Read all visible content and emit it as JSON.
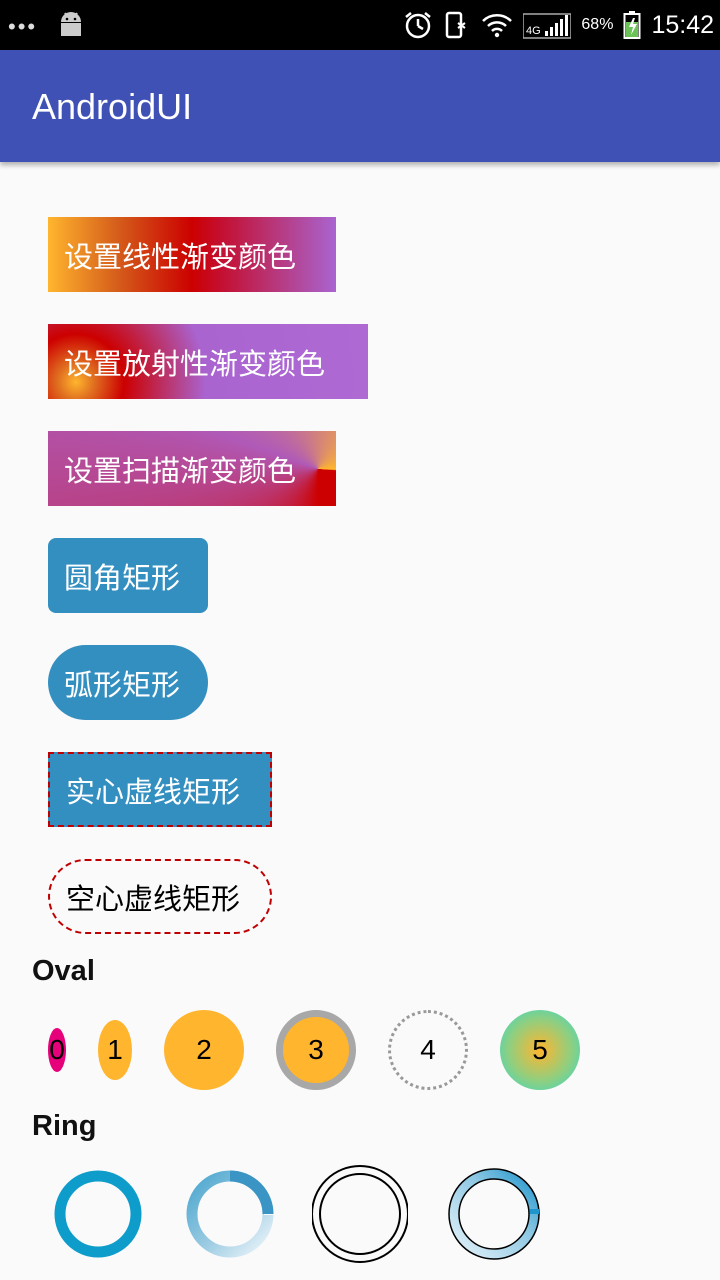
{
  "status_bar": {
    "time": "15:42",
    "battery_percent": "68%",
    "network": "4G",
    "icons": [
      "more-dots-icon",
      "android-icon",
      "alarm-icon",
      "vibrate-icon",
      "wifi-icon",
      "signal-icon",
      "battery-charging-icon"
    ]
  },
  "app_bar": {
    "title": "AndroidUI"
  },
  "buttons": [
    {
      "label": "设置线性渐变颜色"
    },
    {
      "label": "设置放射性渐变颜色"
    },
    {
      "label": "设置扫描渐变颜色"
    },
    {
      "label": "圆角矩形"
    },
    {
      "label": "弧形矩形"
    },
    {
      "label": "实心虚线矩形"
    },
    {
      "label": "空心虚线矩形"
    }
  ],
  "oval_section": {
    "title": "Oval",
    "items": [
      "0",
      "1",
      "2",
      "3",
      "4",
      "5"
    ]
  },
  "ring_section": {
    "title": "Ring"
  },
  "colors": {
    "app_bar": "#3f51b5",
    "button_blue": "#348fc1",
    "accent_orange": "#ffb52e",
    "accent_red": "#cc0000",
    "accent_purple": "#a964d0",
    "ring_blue": "#0e9ccb"
  }
}
